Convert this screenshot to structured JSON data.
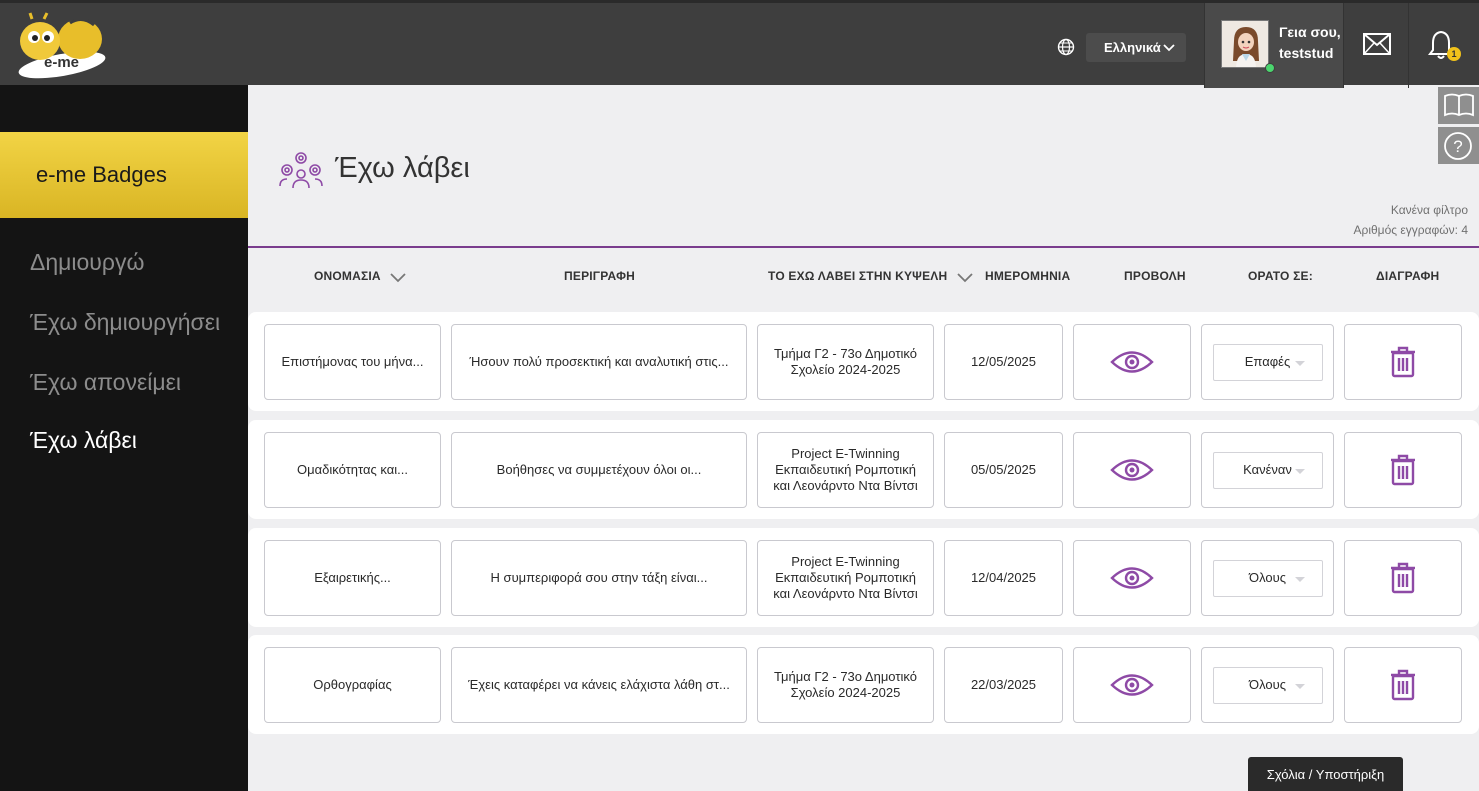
{
  "header": {
    "logo_text": "e-me",
    "language": "Ελληνικά",
    "greeting": "Γεια σου,",
    "username": "teststud",
    "notification_count": "1"
  },
  "sidebar": {
    "title": "e-me Badges",
    "items": [
      {
        "label": "Δημιουργώ"
      },
      {
        "label": "Έχω δημιουργήσει"
      },
      {
        "label": "Έχω απονείμει"
      },
      {
        "label": "Έχω λάβει"
      }
    ]
  },
  "page": {
    "title": "Έχω λάβει",
    "filter_text": "Κανένα φίλτρο",
    "records_text": "Αριθμός εγγραφών: 4"
  },
  "table": {
    "columns": [
      {
        "label": "ΟΝΟΜΑΣΙΑ"
      },
      {
        "label": "ΠΕΡΙΓΡΑΦΗ"
      },
      {
        "label": "ΤΟ ΕΧΩ ΛΑΒΕΙ ΣΤΗΝ ΚΥΨΕΛΗ"
      },
      {
        "label": "ΗΜΕΡΟΜΗΝΙΑ"
      },
      {
        "label": "ΠΡΟΒΟΛΗ"
      },
      {
        "label": "ΟΡΑΤΟ ΣΕ:"
      },
      {
        "label": "ΔΙΑΓΡΑΦΗ"
      }
    ],
    "rows": [
      {
        "name": "Επιστήμονας του μήνα...",
        "description": "Ήσουν πολύ προσεκτική και αναλυτική στις...",
        "hive": "Τμήμα Γ2 - 73ο Δημοτικό Σχολείο 2024-2025",
        "date": "12/05/2025",
        "visibility": "Επαφές"
      },
      {
        "name": "Ομαδικότητας και...",
        "description": "Βοήθησες να συμμετέχουν όλοι οι...",
        "hive": "Project E-Twinning Εκπαιδευτική Ρομποτική και Λεονάρντο Ντα Βίντσι",
        "date": "05/05/2025",
        "visibility": "Κανέναν"
      },
      {
        "name": "Εξαιρετικής...",
        "description": "Η συμπεριφορά σου στην τάξη είναι...",
        "hive": "Project E-Twinning Εκπαιδευτική Ρομποτική και Λεονάρντο Ντα Βίντσι",
        "date": "12/04/2025",
        "visibility": "Όλους"
      },
      {
        "name": "Ορθογραφίας",
        "description": "Έχεις καταφέρει να κάνεις ελάχιστα λάθη στ...",
        "hive": "Τμήμα Γ2 - 73ο Δημοτικό Σχολείο 2024-2025",
        "date": "22/03/2025",
        "visibility": "Όλους"
      }
    ]
  },
  "footer": {
    "feedback_label": "Σχόλια / Υποστήριξη"
  },
  "colors": {
    "accent_purple": "#8e4aa6",
    "brand_yellow": "#f2d445"
  }
}
